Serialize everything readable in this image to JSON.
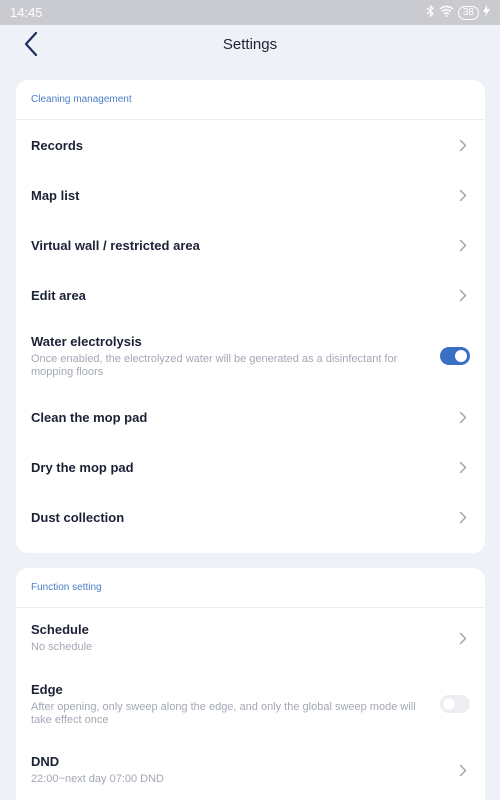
{
  "status_bar": {
    "time": "14:45",
    "battery": "38",
    "icons": [
      "bluetooth-icon",
      "wifi-icon",
      "battery-icon",
      "charging-icon"
    ]
  },
  "header": {
    "title": "Settings",
    "back_icon": "chevron-left-icon"
  },
  "cleaning_management": {
    "title": "Cleaning management",
    "items": [
      {
        "label": "Records"
      },
      {
        "label": "Map list"
      },
      {
        "label": "Virtual wall / restricted area"
      },
      {
        "label": "Edit area"
      },
      {
        "label": "Water electrolysis",
        "description": "Once enabled, the electrolyzed water will be generated as a disinfectant for mopping floors",
        "toggle": true
      },
      {
        "label": "Clean the mop pad"
      },
      {
        "label": "Dry the mop pad"
      },
      {
        "label": "Dust collection"
      }
    ]
  },
  "function_setting": {
    "title": "Function setting",
    "items": [
      {
        "label": "Schedule",
        "description": "No schedule"
      },
      {
        "label": "Edge",
        "description": "After opening, only sweep along the edge, and only the global sweep mode will take effect once",
        "toggle": false
      },
      {
        "label": "DND",
        "description": "22:00~next day 07:00 DND"
      }
    ]
  },
  "colors": {
    "accent": "#3a70c3",
    "section_title": "#4a7fc9",
    "background": "#eef1f8"
  }
}
